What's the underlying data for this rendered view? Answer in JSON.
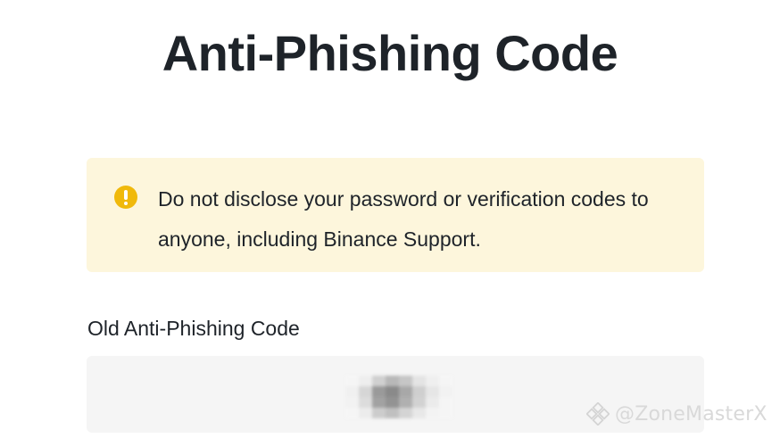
{
  "title": "Anti-Phishing Code",
  "warning": {
    "icon": "exclamation-circle-icon",
    "icon_color": "#f0b90b",
    "background_color": "#fdf6dc",
    "text": "Do not disclose your password or verification codes to anyone, including Binance Support."
  },
  "old_code_field": {
    "label": "Old Anti-Phishing Code",
    "value_state": "obscured",
    "background_color": "#f5f5f5"
  },
  "watermark": {
    "logo": "binance-logo",
    "text": "@ZoneMasterX"
  }
}
